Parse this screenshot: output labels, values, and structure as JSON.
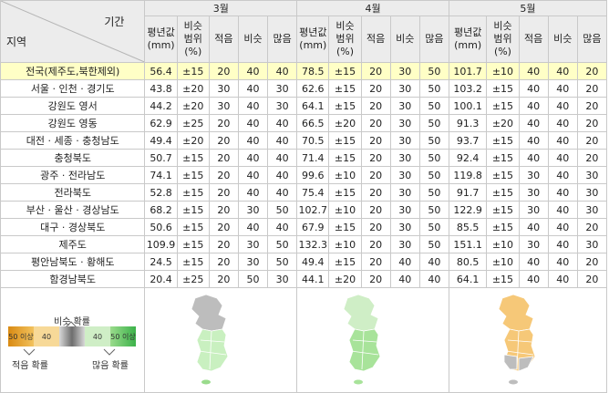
{
  "header": {
    "corner_period": "기간",
    "corner_region": "지역",
    "months": [
      "3월",
      "4월",
      "5월"
    ],
    "sub": [
      "평년값\n(mm)",
      "비슷\n범위\n(%)",
      "적음",
      "비슷",
      "많음"
    ]
  },
  "rows": [
    {
      "region": "전국(제주도,북한제외)",
      "m3": [
        "56.4",
        "±15",
        "20",
        "40",
        "40"
      ],
      "m4": [
        "78.5",
        "±15",
        "20",
        "30",
        "50"
      ],
      "m5": [
        "101.7",
        "±10",
        "40",
        "40",
        "20"
      ]
    },
    {
      "region": "서울 · 인천 · 경기도",
      "m3": [
        "43.8",
        "±20",
        "30",
        "40",
        "30"
      ],
      "m4": [
        "62.6",
        "±15",
        "20",
        "30",
        "50"
      ],
      "m5": [
        "103.2",
        "±15",
        "40",
        "40",
        "20"
      ]
    },
    {
      "region": "강원도 영서",
      "m3": [
        "44.2",
        "±20",
        "30",
        "40",
        "30"
      ],
      "m4": [
        "64.1",
        "±15",
        "20",
        "30",
        "50"
      ],
      "m5": [
        "100.1",
        "±15",
        "40",
        "40",
        "20"
      ]
    },
    {
      "region": "강원도 영동",
      "m3": [
        "62.9",
        "±25",
        "20",
        "40",
        "40"
      ],
      "m4": [
        "66.5",
        "±20",
        "20",
        "30",
        "50"
      ],
      "m5": [
        "91.3",
        "±20",
        "40",
        "40",
        "20"
      ]
    },
    {
      "region": "대전 · 세종 · 충청남도",
      "m3": [
        "49.4",
        "±20",
        "20",
        "40",
        "40"
      ],
      "m4": [
        "70.5",
        "±15",
        "20",
        "30",
        "50"
      ],
      "m5": [
        "93.7",
        "±15",
        "40",
        "40",
        "20"
      ]
    },
    {
      "region": "충청북도",
      "m3": [
        "50.7",
        "±15",
        "20",
        "40",
        "40"
      ],
      "m4": [
        "71.4",
        "±15",
        "20",
        "30",
        "50"
      ],
      "m5": [
        "92.4",
        "±15",
        "40",
        "40",
        "20"
      ]
    },
    {
      "region": "광주 · 전라남도",
      "m3": [
        "74.1",
        "±15",
        "20",
        "40",
        "40"
      ],
      "m4": [
        "99.6",
        "±10",
        "20",
        "30",
        "50"
      ],
      "m5": [
        "119.8",
        "±15",
        "30",
        "40",
        "30"
      ]
    },
    {
      "region": "전라북도",
      "m3": [
        "52.8",
        "±15",
        "20",
        "40",
        "40"
      ],
      "m4": [
        "75.4",
        "±15",
        "20",
        "30",
        "50"
      ],
      "m5": [
        "91.7",
        "±15",
        "30",
        "40",
        "30"
      ]
    },
    {
      "region": "부산 · 울산 · 경상남도",
      "m3": [
        "68.2",
        "±15",
        "20",
        "30",
        "50"
      ],
      "m4": [
        "102.7",
        "±10",
        "20",
        "30",
        "50"
      ],
      "m5": [
        "122.9",
        "±15",
        "30",
        "40",
        "30"
      ]
    },
    {
      "region": "대구 · 경상북도",
      "m3": [
        "50.6",
        "±15",
        "20",
        "40",
        "40"
      ],
      "m4": [
        "67.9",
        "±15",
        "20",
        "30",
        "50"
      ],
      "m5": [
        "85.5",
        "±15",
        "40",
        "40",
        "20"
      ]
    },
    {
      "region": "제주도",
      "m3": [
        "109.9",
        "±15",
        "20",
        "30",
        "50"
      ],
      "m4": [
        "132.3",
        "±10",
        "20",
        "30",
        "50"
      ],
      "m5": [
        "151.1",
        "±10",
        "30",
        "40",
        "30"
      ]
    },
    {
      "region": "평안남북도 · 황해도",
      "m3": [
        "24.5",
        "±15",
        "20",
        "30",
        "50"
      ],
      "m4": [
        "49.4",
        "±15",
        "20",
        "40",
        "40"
      ],
      "m5": [
        "80.5",
        "±10",
        "40",
        "40",
        "20"
      ]
    },
    {
      "region": "함경남북도",
      "m3": [
        "20.4",
        "±25",
        "20",
        "50",
        "30"
      ],
      "m4": [
        "44.1",
        "±20",
        "20",
        "40",
        "40"
      ],
      "m5": [
        "64.1",
        "±15",
        "40",
        "40",
        "20"
      ]
    }
  ],
  "legend": {
    "similar_label": "비슷 확률",
    "low_label": "적음 확률",
    "high_label": "많음 확률",
    "bar": [
      "50 이상",
      "40",
      "",
      "40",
      "50 이상"
    ]
  },
  "colors": {
    "highlight_row": "#ffffc6",
    "header_bg": "#ececec",
    "low": "#e9a52a",
    "similar": "#8e8e8e",
    "high": "#9adb8c",
    "map_mar_south": "#c9f0c0",
    "map_apr": "#a8e39a",
    "map_may": "#f6c878"
  }
}
